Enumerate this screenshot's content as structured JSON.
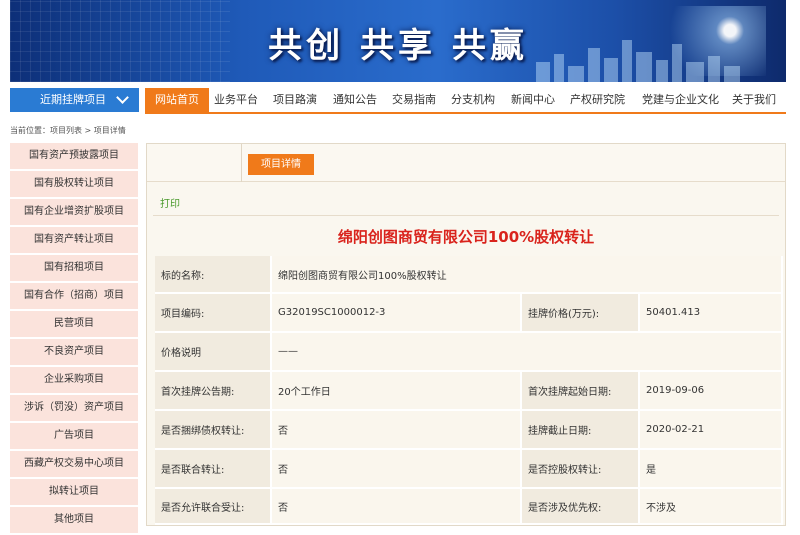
{
  "banner": {
    "slogan": "共创 共享 共赢"
  },
  "nav": {
    "recent_label": "近期挂牌项目",
    "items": [
      "网站首页",
      "业务平台",
      "项目路演",
      "通知公告",
      "交易指南",
      "分支机构",
      "新闻中心",
      "产权研究院",
      "党建与企业文化",
      "关于我们"
    ]
  },
  "breadcrumb": "当前位置：项目列表 > 项目详情",
  "sidebar": {
    "items": [
      "国有资产预披露项目",
      "国有股权转让项目",
      "国有企业增资扩股项目",
      "国有资产转让项目",
      "国有招租项目",
      "国有合作（招商）项目",
      "民营项目",
      "不良资产项目",
      "企业采购项目",
      "涉诉（罚没）资产项目",
      "广告项目",
      "西藏产权交易中心项目",
      "拟转让项目",
      "其他项目"
    ]
  },
  "detail": {
    "tab_label": "项目详情",
    "print_label": "打印",
    "title": "绵阳创图商贸有限公司100%股权转让",
    "rows": {
      "r0": {
        "label": "标的名称:",
        "value": "绵阳创图商贸有限公司100%股权转让"
      },
      "r1": {
        "label": "项目编码:",
        "value": "G32019SC1000012-3",
        "label2": "挂牌价格(万元):",
        "value2": "50401.413"
      },
      "r2": {
        "label": "价格说明",
        "value": "——"
      },
      "r3": {
        "label": "首次挂牌公告期:",
        "value": "20个工作日",
        "label2": "首次挂牌起始日期:",
        "value2": "2019-09-06"
      },
      "r4": {
        "label": "是否捆绑债权转让:",
        "value": "否",
        "label2": "挂牌截止日期:",
        "value2": "2020-02-21"
      },
      "r5": {
        "label": "是否联合转让:",
        "value": "否",
        "label2": "是否控股权转让:",
        "value2": "是"
      },
      "r6": {
        "label": "是否允许联合受让:",
        "value": "否",
        "label2": "是否涉及优先权:",
        "value2": "不涉及"
      }
    }
  },
  "colors": {
    "accent": "#f07a1a",
    "nav_blue": "#2a7bd3",
    "title_red": "#d9231c",
    "sidebar_bg": "#fbe3dc"
  }
}
